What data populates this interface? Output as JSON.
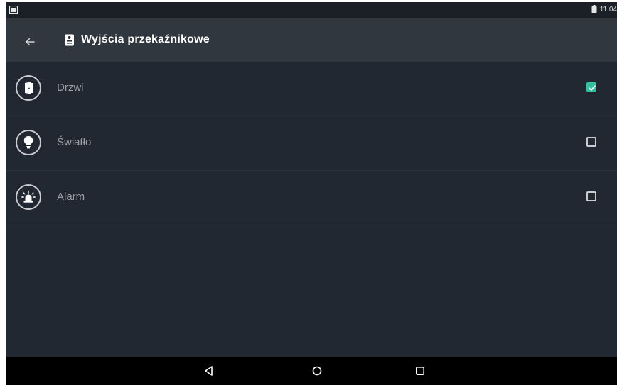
{
  "status_bar": {
    "time": "11:04",
    "left_icon": "notification-icon",
    "battery_icon": "battery-icon"
  },
  "app_bar": {
    "title": "Wyjścia przekaźnikowe",
    "back_icon": "arrow-back-icon",
    "title_icon": "intercom-icon"
  },
  "relays": [
    {
      "label": "Drzwi",
      "icon": "door-icon",
      "checked": true
    },
    {
      "label": "Światło",
      "icon": "bulb-icon",
      "checked": false
    },
    {
      "label": "Alarm",
      "icon": "siren-icon",
      "checked": false
    }
  ],
  "nav_bar": {
    "back": "nav-back-icon",
    "home": "nav-home-icon",
    "recents": "nav-recents-icon"
  },
  "colors": {
    "background": "#222831",
    "app_bar": "#31373f",
    "checkbox_checked": "#38bfa2",
    "label": "#9aa0a6"
  }
}
